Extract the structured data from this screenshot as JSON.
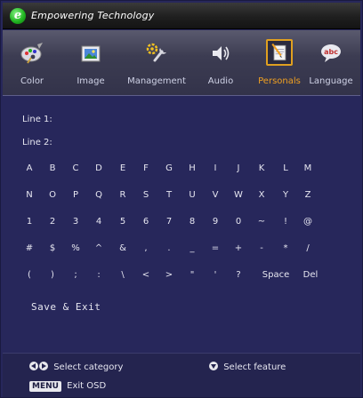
{
  "title_bar": {
    "brand_logo_letter": "e",
    "brand_text": "Empowering Technology"
  },
  "tabs": [
    {
      "label": "Color",
      "icon": "palette-icon"
    },
    {
      "label": "Image",
      "icon": "image-icon"
    },
    {
      "label": "Management",
      "icon": "tools-icon"
    },
    {
      "label": "Audio",
      "icon": "speaker-icon"
    },
    {
      "label": "Personals",
      "icon": "notepad-icon",
      "active": true
    },
    {
      "label": "Language",
      "icon": "speech-bubble-abc-icon"
    }
  ],
  "form": {
    "line1_label": "Line 1:",
    "line2_label": "Line 2:"
  },
  "keyboard": {
    "rows": [
      [
        "A",
        "B",
        "C",
        "D",
        "E",
        "F",
        "G",
        "H",
        "I",
        "J",
        "K",
        "L",
        "M"
      ],
      [
        "N",
        "O",
        "P",
        "Q",
        "R",
        "S",
        "T",
        "U",
        "V",
        "W",
        "X",
        "Y",
        "Z"
      ],
      [
        "1",
        "2",
        "3",
        "4",
        "5",
        "6",
        "7",
        "8",
        "9",
        "0",
        "~",
        "!",
        "@"
      ],
      [
        "#",
        "$",
        "%",
        "^",
        "&",
        ",",
        ".",
        "_",
        "=",
        "+",
        "-",
        "*",
        "/"
      ],
      [
        "(",
        ")",
        ";",
        ":",
        "\\",
        "<",
        ">",
        "\"",
        "'",
        "?",
        "Space",
        "Del"
      ]
    ]
  },
  "actions": {
    "save_exit": "Save & Exit"
  },
  "footer": {
    "select_category": "Select category",
    "select_feature": "Select feature",
    "menu_key": "MENU",
    "exit_osd": "Exit OSD"
  },
  "colors": {
    "background": "#27275b",
    "active_accent": "#f0a021",
    "text": "#e6e6f0"
  }
}
